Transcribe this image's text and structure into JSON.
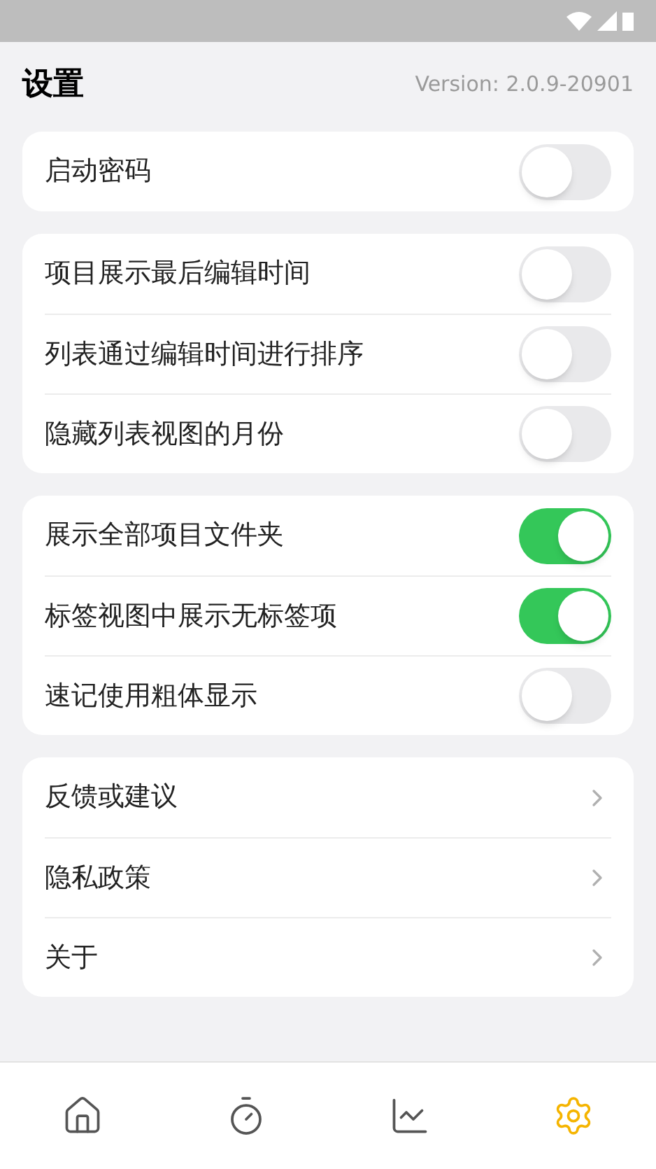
{
  "header": {
    "title": "设置",
    "version": "Version: 2.0.9-20901"
  },
  "sections": [
    {
      "rows": [
        {
          "kind": "toggle",
          "label": "启动密码",
          "on": false
        }
      ]
    },
    {
      "rows": [
        {
          "kind": "toggle",
          "label": "项目展示最后编辑时间",
          "on": false
        },
        {
          "kind": "toggle",
          "label": "列表通过编辑时间进行排序",
          "on": false
        },
        {
          "kind": "toggle",
          "label": "隐藏列表视图的月份",
          "on": false
        }
      ]
    },
    {
      "rows": [
        {
          "kind": "toggle",
          "label": "展示全部项目文件夹",
          "on": true
        },
        {
          "kind": "toggle",
          "label": "标签视图中展示无标签项",
          "on": true
        },
        {
          "kind": "toggle",
          "label": "速记使用粗体显示",
          "on": false
        }
      ]
    },
    {
      "rows": [
        {
          "kind": "link",
          "label": "反馈或建议"
        },
        {
          "kind": "link",
          "label": "隐私政策"
        },
        {
          "kind": "link",
          "label": "关于"
        }
      ]
    }
  ],
  "tab_bar": [
    {
      "kind": "home",
      "selected": false
    },
    {
      "kind": "timer",
      "selected": false
    },
    {
      "kind": "chart",
      "selected": false
    },
    {
      "kind": "settings",
      "selected": true
    }
  ]
}
